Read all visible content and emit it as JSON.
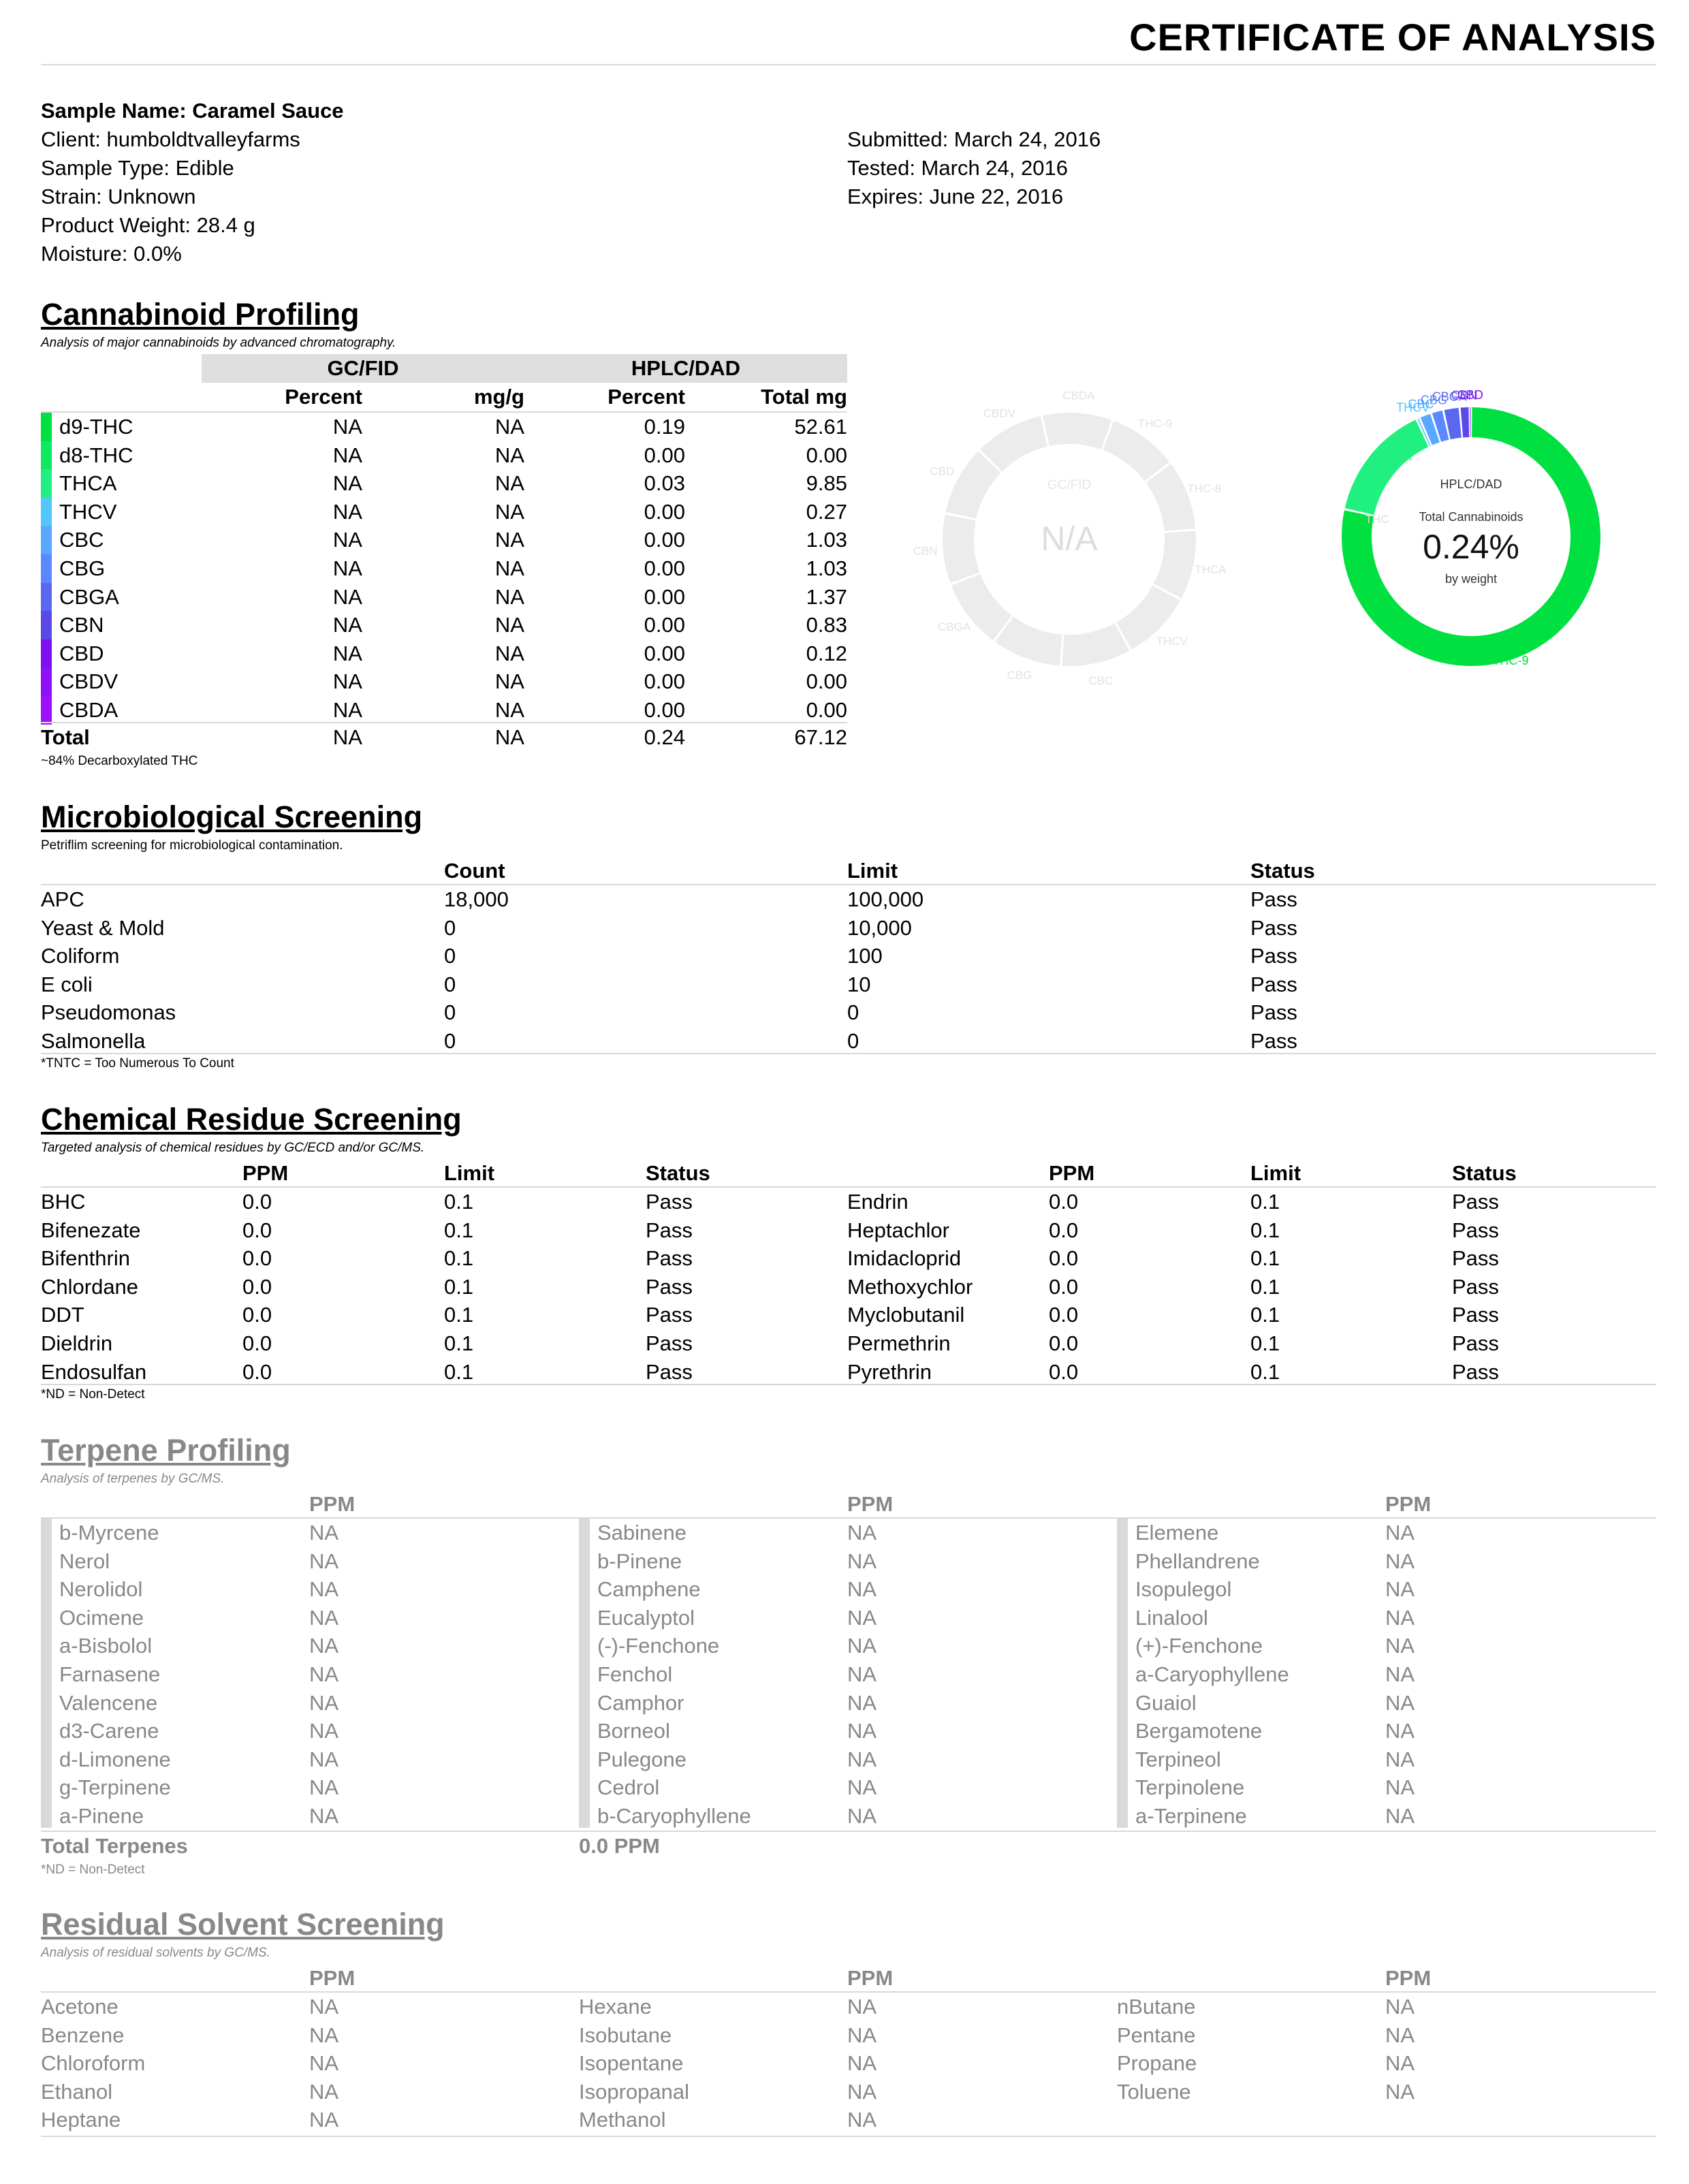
{
  "title": "CERTIFICATE OF ANALYSIS",
  "sample": {
    "name": "Sample Name: Caramel Sauce",
    "client": "Client: humboldtvalleyfarms",
    "type": "Sample Type: Edible",
    "strain": "Strain: Unknown",
    "weight": "Product Weight: 28.4 g",
    "moisture": "Moisture: 0.0%",
    "submitted": "Submitted: March 24, 2016",
    "tested": "Tested: March 24, 2016",
    "expires": "Expires: June 22, 2016"
  },
  "cannabinoid": {
    "title": "Cannabinoid Profiling",
    "subtitle": "Analysis of major cannabinoids by advanced chromatography.",
    "group1": "GC/FID",
    "group2": "HPLC/DAD",
    "columns": [
      "Percent",
      "mg/g",
      "Percent",
      "Total mg"
    ],
    "rows": [
      {
        "name": "d9-THC",
        "a": "NA",
        "b": "NA",
        "c": "0.19",
        "d": "52.61",
        "color": "#00e040"
      },
      {
        "name": "d8-THC",
        "a": "NA",
        "b": "NA",
        "c": "0.00",
        "d": "0.00",
        "color": "#10e860"
      },
      {
        "name": "THCA",
        "a": "NA",
        "b": "NA",
        "c": "0.03",
        "d": "9.85",
        "color": "#20f080"
      },
      {
        "name": "THCV",
        "a": "NA",
        "b": "NA",
        "c": "0.00",
        "d": "0.27",
        "color": "#50c8ff"
      },
      {
        "name": "CBC",
        "a": "NA",
        "b": "NA",
        "c": "0.00",
        "d": "1.03",
        "color": "#5aa8ff"
      },
      {
        "name": "CBG",
        "a": "NA",
        "b": "NA",
        "c": "0.00",
        "d": "1.03",
        "color": "#5a88ff"
      },
      {
        "name": "CBGA",
        "a": "NA",
        "b": "NA",
        "c": "0.00",
        "d": "1.37",
        "color": "#5a68f0"
      },
      {
        "name": "CBN",
        "a": "NA",
        "b": "NA",
        "c": "0.00",
        "d": "0.83",
        "color": "#5a48e8"
      },
      {
        "name": "CBD",
        "a": "NA",
        "b": "NA",
        "c": "0.00",
        "d": "0.12",
        "color": "#8010f0"
      },
      {
        "name": "CBDV",
        "a": "NA",
        "b": "NA",
        "c": "0.00",
        "d": "0.00",
        "color": "#9010f8"
      },
      {
        "name": "CBDA",
        "a": "NA",
        "b": "NA",
        "c": "0.00",
        "d": "0.00",
        "color": "#a010ff"
      }
    ],
    "total": {
      "name": "Total",
      "a": "NA",
      "b": "NA",
      "c": "0.24",
      "d": "67.12"
    },
    "footnote": "~84% Decarboxylated THC",
    "gc_donut": {
      "center_label": "GC/FID",
      "value": "N/A",
      "labels": [
        "CBDA",
        "THC-9",
        "THC-8",
        "THCA",
        "THCV",
        "CBC",
        "CBG",
        "CBGA",
        "CBN",
        "CBD",
        "CBDV"
      ]
    },
    "hplc_donut": {
      "center_label": "HPLC/DAD",
      "caption": "Total Cannabinoids",
      "value": "0.24%",
      "sub": "by weight",
      "slice_labels": [
        "THC-9",
        "THCA",
        "THCV",
        "CBC",
        "CBG",
        "CBGA",
        "CBN",
        "CBD"
      ],
      "faint_label": "THC"
    }
  },
  "micro": {
    "title": "Microbiological Screening",
    "subtitle": "Petriflim screening for microbiological contamination.",
    "columns": [
      "Count",
      "Limit",
      "Status"
    ],
    "rows": [
      {
        "name": "APC",
        "count": "18,000",
        "limit": "100,000",
        "status": "Pass"
      },
      {
        "name": "Yeast & Mold",
        "count": "0",
        "limit": "10,000",
        "status": "Pass"
      },
      {
        "name": "Coliform",
        "count": "0",
        "limit": "100",
        "status": "Pass"
      },
      {
        "name": "E coli",
        "count": "0",
        "limit": "10",
        "status": "Pass"
      },
      {
        "name": "Pseudomonas",
        "count": "0",
        "limit": "0",
        "status": "Pass"
      },
      {
        "name": "Salmonella",
        "count": "0",
        "limit": "0",
        "status": "Pass"
      }
    ],
    "footnote": "*TNTC = Too Numerous To Count"
  },
  "chem": {
    "title": "Chemical Residue Screening",
    "subtitle": "Targeted analysis of chemical residues by GC/ECD and/or GC/MS.",
    "columns": [
      "PPM",
      "Limit",
      "Status"
    ],
    "rows_left": [
      {
        "name": "BHC",
        "ppm": "0.0",
        "limit": "0.1",
        "status": "Pass"
      },
      {
        "name": "Bifenezate",
        "ppm": "0.0",
        "limit": "0.1",
        "status": "Pass"
      },
      {
        "name": "Bifenthrin",
        "ppm": "0.0",
        "limit": "0.1",
        "status": "Pass"
      },
      {
        "name": "Chlordane",
        "ppm": "0.0",
        "limit": "0.1",
        "status": "Pass"
      },
      {
        "name": "DDT",
        "ppm": "0.0",
        "limit": "0.1",
        "status": "Pass"
      },
      {
        "name": "Dieldrin",
        "ppm": "0.0",
        "limit": "0.1",
        "status": "Pass"
      },
      {
        "name": "Endosulfan",
        "ppm": "0.0",
        "limit": "0.1",
        "status": "Pass"
      }
    ],
    "rows_right": [
      {
        "name": "Endrin",
        "ppm": "0.0",
        "limit": "0.1",
        "status": "Pass"
      },
      {
        "name": "Heptachlor",
        "ppm": "0.0",
        "limit": "0.1",
        "status": "Pass"
      },
      {
        "name": "Imidacloprid",
        "ppm": "0.0",
        "limit": "0.1",
        "status": "Pass"
      },
      {
        "name": "Methoxychlor",
        "ppm": "0.0",
        "limit": "0.1",
        "status": "Pass"
      },
      {
        "name": "Myclobutanil",
        "ppm": "0.0",
        "limit": "0.1",
        "status": "Pass"
      },
      {
        "name": "Permethrin",
        "ppm": "0.0",
        "limit": "0.1",
        "status": "Pass"
      },
      {
        "name": "Pyrethrin",
        "ppm": "0.0",
        "limit": "0.1",
        "status": "Pass"
      }
    ],
    "footnote": "*ND = Non-Detect"
  },
  "terpene": {
    "title": "Terpene Profiling",
    "subtitle": "Analysis of terpenes by GC/MS.",
    "column": "PPM",
    "cols": [
      [
        {
          "name": "b-Myrcene",
          "v": "NA"
        },
        {
          "name": "Nerol",
          "v": "NA"
        },
        {
          "name": "Nerolidol",
          "v": "NA"
        },
        {
          "name": "Ocimene",
          "v": "NA"
        },
        {
          "name": "a-Bisbolol",
          "v": "NA"
        },
        {
          "name": "Farnasene",
          "v": "NA"
        },
        {
          "name": "Valencene",
          "v": "NA"
        },
        {
          "name": "d3-Carene",
          "v": "NA"
        },
        {
          "name": "d-Limonene",
          "v": "NA"
        },
        {
          "name": "g-Terpinene",
          "v": "NA"
        },
        {
          "name": "a-Pinene",
          "v": "NA"
        }
      ],
      [
        {
          "name": "Sabinene",
          "v": "NA"
        },
        {
          "name": "b-Pinene",
          "v": "NA"
        },
        {
          "name": "Camphene",
          "v": "NA"
        },
        {
          "name": "Eucalyptol",
          "v": "NA"
        },
        {
          "name": "(-)-Fenchone",
          "v": "NA"
        },
        {
          "name": "Fenchol",
          "v": "NA"
        },
        {
          "name": "Camphor",
          "v": "NA"
        },
        {
          "name": "Borneol",
          "v": "NA"
        },
        {
          "name": "Pulegone",
          "v": "NA"
        },
        {
          "name": "Cedrol",
          "v": "NA"
        },
        {
          "name": "b-Caryophyllene",
          "v": "NA"
        }
      ],
      [
        {
          "name": "Elemene",
          "v": "NA"
        },
        {
          "name": "Phellandrene",
          "v": "NA"
        },
        {
          "name": "Isopulegol",
          "v": "NA"
        },
        {
          "name": "Linalool",
          "v": "NA"
        },
        {
          "name": "(+)-Fenchone",
          "v": "NA"
        },
        {
          "name": "a-Caryophyllene",
          "v": "NA"
        },
        {
          "name": "Guaiol",
          "v": "NA"
        },
        {
          "name": "Bergamotene",
          "v": "NA"
        },
        {
          "name": "Terpineol",
          "v": "NA"
        },
        {
          "name": "Terpinolene",
          "v": "NA"
        },
        {
          "name": "a-Terpinene",
          "v": "NA"
        }
      ]
    ],
    "total_label": "Total Terpenes",
    "total_value": "0.0 PPM",
    "footnote": "*ND = Non-Detect"
  },
  "solvent": {
    "title": "Residual Solvent Screening",
    "subtitle": "Analysis of residual solvents by GC/MS.",
    "column": "PPM",
    "cols": [
      [
        {
          "name": "Acetone",
          "v": "NA"
        },
        {
          "name": "Benzene",
          "v": "NA"
        },
        {
          "name": "Chloroform",
          "v": "NA"
        },
        {
          "name": "Ethanol",
          "v": "NA"
        },
        {
          "name": "Heptane",
          "v": "NA"
        }
      ],
      [
        {
          "name": "Hexane",
          "v": "NA"
        },
        {
          "name": "Isobutane",
          "v": "NA"
        },
        {
          "name": "Isopentane",
          "v": "NA"
        },
        {
          "name": "Isopropanal",
          "v": "NA"
        },
        {
          "name": "Methanol",
          "v": "NA"
        }
      ],
      [
        {
          "name": "nButane",
          "v": "NA"
        },
        {
          "name": "Pentane",
          "v": "NA"
        },
        {
          "name": "Propane",
          "v": "NA"
        },
        {
          "name": "Toluene",
          "v": "NA"
        }
      ]
    ]
  }
}
